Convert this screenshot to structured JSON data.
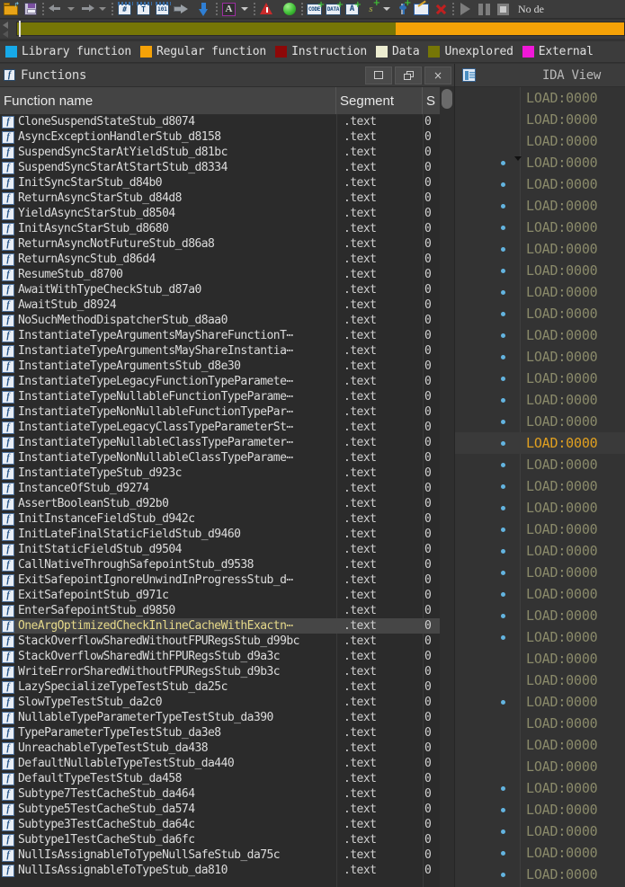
{
  "toolbar": {
    "items": [
      {
        "name": "open-file-icon",
        "kind": "folder"
      },
      {
        "name": "save-icon",
        "kind": "disk"
      },
      {
        "name": "toolbar-separator-1",
        "kind": "sep"
      },
      {
        "name": "navigate-back-icon",
        "kind": "arrow-left"
      },
      {
        "name": "navigate-back-dropdown-icon",
        "kind": "caret"
      },
      {
        "name": "navigate-forward-icon",
        "kind": "arrow-right"
      },
      {
        "name": "navigate-forward-dropdown-icon",
        "kind": "caret-dim"
      },
      {
        "name": "toolbar-separator-2",
        "kind": "sep"
      },
      {
        "name": "make-code-icon",
        "kind": "box",
        "glyph": "#"
      },
      {
        "name": "make-text-icon",
        "kind": "box",
        "glyph": "T"
      },
      {
        "name": "make-data-icon",
        "kind": "box",
        "glyph": "101"
      },
      {
        "name": "jump-icon",
        "kind": "jump"
      },
      {
        "name": "jump-down-icon",
        "kind": "down-arrow"
      },
      {
        "name": "toolbar-separator-3",
        "kind": "sep"
      },
      {
        "name": "font-icon",
        "kind": "letter-a",
        "glyph": "A"
      },
      {
        "name": "font-dropdown-icon",
        "kind": "caret"
      },
      {
        "name": "toolbar-separator-4",
        "kind": "sep"
      },
      {
        "name": "problems-icon",
        "kind": "warn"
      },
      {
        "name": "debugger-status-icon",
        "kind": "green-ball"
      },
      {
        "name": "toolbar-separator-5",
        "kind": "sep"
      },
      {
        "name": "add-code-segment-icon",
        "kind": "label-plus",
        "glyph": "CODE"
      },
      {
        "name": "add-data-segment-icon",
        "kind": "label-plus",
        "glyph": "DATA"
      },
      {
        "name": "add-struct-icon",
        "kind": "box-plus",
        "glyph": "A"
      },
      {
        "name": "add-string-icon",
        "kind": "s-plus",
        "glyph": "s"
      },
      {
        "name": "add-string-dropdown-icon",
        "kind": "caret"
      },
      {
        "name": "add-breakpoint-icon",
        "kind": "pin-plus"
      },
      {
        "name": "edit-icon",
        "kind": "edit"
      },
      {
        "name": "delete-icon",
        "kind": "red-x"
      },
      {
        "name": "toolbar-separator-6",
        "kind": "sep"
      },
      {
        "name": "run-icon",
        "kind": "play"
      },
      {
        "name": "pause-icon",
        "kind": "pause"
      },
      {
        "name": "stop-icon",
        "kind": "stop"
      }
    ],
    "status_text": "No de"
  },
  "navband": {
    "segments": [
      {
        "name": "nav-segment-unexplored",
        "color": "#767606",
        "width_pct": 62.3
      },
      {
        "name": "nav-segment-regular-function",
        "color": "#f5a207",
        "width_pct": 37.7
      }
    ],
    "cursor_pct": 0.35
  },
  "legend": {
    "items": [
      {
        "label": "Library function",
        "color": "#17a9e8"
      },
      {
        "label": "Regular function",
        "color": "#f5a207"
      },
      {
        "label": "Instruction",
        "color": "#8d0808"
      },
      {
        "label": "Data",
        "color": "#ececd0"
      },
      {
        "label": "Unexplored",
        "color": "#767606"
      },
      {
        "label": "External",
        "color": "#f018d8"
      }
    ]
  },
  "functions_panel": {
    "title": "Functions",
    "title_icon": "function-icon",
    "window_buttons": [
      {
        "name": "maximize-button",
        "glyph": "maximize"
      },
      {
        "name": "restore-button",
        "glyph": "restore"
      },
      {
        "name": "close-button",
        "glyph": "×"
      }
    ],
    "columns": [
      "Function name",
      "Segment",
      "S"
    ],
    "selected_index": 33,
    "rows": [
      {
        "name": "CloneSuspendStateStub_d8074",
        "segment": ".text",
        "s": "0"
      },
      {
        "name": "AsyncExceptionHandlerStub_d8158",
        "segment": ".text",
        "s": "0"
      },
      {
        "name": "SuspendSyncStarAtYieldStub_d81bc",
        "segment": ".text",
        "s": "0"
      },
      {
        "name": "SuspendSyncStarAtStartStub_d8334",
        "segment": ".text",
        "s": "0"
      },
      {
        "name": "InitSyncStarStub_d84b0",
        "segment": ".text",
        "s": "0"
      },
      {
        "name": "ReturnAsyncStarStub_d84d8",
        "segment": ".text",
        "s": "0"
      },
      {
        "name": "YieldAsyncStarStub_d8504",
        "segment": ".text",
        "s": "0"
      },
      {
        "name": "InitAsyncStarStub_d8680",
        "segment": ".text",
        "s": "0"
      },
      {
        "name": "ReturnAsyncNotFutureStub_d86a8",
        "segment": ".text",
        "s": "0"
      },
      {
        "name": "ReturnAsyncStub_d86d4",
        "segment": ".text",
        "s": "0"
      },
      {
        "name": "ResumeStub_d8700",
        "segment": ".text",
        "s": "0"
      },
      {
        "name": "AwaitWithTypeCheckStub_d87a0",
        "segment": ".text",
        "s": "0"
      },
      {
        "name": "AwaitStub_d8924",
        "segment": ".text",
        "s": "0"
      },
      {
        "name": "NoSuchMethodDispatcherStub_d8aa0",
        "segment": ".text",
        "s": "0"
      },
      {
        "name": "InstantiateTypeArgumentsMayShareFunctionT⋯",
        "segment": ".text",
        "s": "0"
      },
      {
        "name": "InstantiateTypeArgumentsMayShareInstantia⋯",
        "segment": ".text",
        "s": "0"
      },
      {
        "name": "InstantiateTypeArgumentsStub_d8e30",
        "segment": ".text",
        "s": "0"
      },
      {
        "name": "InstantiateTypeLegacyFunctionTypeParamete⋯",
        "segment": ".text",
        "s": "0"
      },
      {
        "name": "InstantiateTypeNullableFunctionTypeParame⋯",
        "segment": ".text",
        "s": "0"
      },
      {
        "name": "InstantiateTypeNonNullableFunctionTypePar⋯",
        "segment": ".text",
        "s": "0"
      },
      {
        "name": "InstantiateTypeLegacyClassTypeParameterSt⋯",
        "segment": ".text",
        "s": "0"
      },
      {
        "name": "InstantiateTypeNullableClassTypeParameter⋯",
        "segment": ".text",
        "s": "0"
      },
      {
        "name": "InstantiateTypeNonNullableClassTypeParame⋯",
        "segment": ".text",
        "s": "0"
      },
      {
        "name": "InstantiateTypeStub_d923c",
        "segment": ".text",
        "s": "0"
      },
      {
        "name": "InstanceOfStub_d9274",
        "segment": ".text",
        "s": "0"
      },
      {
        "name": "AssertBooleanStub_d92b0",
        "segment": ".text",
        "s": "0"
      },
      {
        "name": "InitInstanceFieldStub_d942c",
        "segment": ".text",
        "s": "0"
      },
      {
        "name": "InitLateFinalStaticFieldStub_d9460",
        "segment": ".text",
        "s": "0"
      },
      {
        "name": "InitStaticFieldStub_d9504",
        "segment": ".text",
        "s": "0"
      },
      {
        "name": "CallNativeThroughSafepointStub_d9538",
        "segment": ".text",
        "s": "0"
      },
      {
        "name": "ExitSafepointIgnoreUnwindInProgressStub_d⋯",
        "segment": ".text",
        "s": "0"
      },
      {
        "name": "ExitSafepointStub_d971c",
        "segment": ".text",
        "s": "0"
      },
      {
        "name": "EnterSafepointStub_d9850",
        "segment": ".text",
        "s": "0"
      },
      {
        "name": "OneArgOptimizedCheckInlineCacheWithExactn⋯",
        "segment": ".text",
        "s": "0"
      },
      {
        "name": "StackOverflowSharedWithoutFPURegsStub_d99bc",
        "segment": ".text",
        "s": "0"
      },
      {
        "name": "StackOverflowSharedWithFPURegsStub_d9a3c",
        "segment": ".text",
        "s": "0"
      },
      {
        "name": "WriteErrorSharedWithoutFPURegsStub_d9b3c",
        "segment": ".text",
        "s": "0"
      },
      {
        "name": "LazySpecializeTypeTestStub_da25c",
        "segment": ".text",
        "s": "0"
      },
      {
        "name": "SlowTypeTestStub_da2c0",
        "segment": ".text",
        "s": "0"
      },
      {
        "name": "NullableTypeParameterTypeTestStub_da390",
        "segment": ".text",
        "s": "0"
      },
      {
        "name": "TypeParameterTypeTestStub_da3e8",
        "segment": ".text",
        "s": "0"
      },
      {
        "name": "UnreachableTypeTestStub_da438",
        "segment": ".text",
        "s": "0"
      },
      {
        "name": "DefaultNullableTypeTestStub_da440",
        "segment": ".text",
        "s": "0"
      },
      {
        "name": "DefaultTypeTestStub_da458",
        "segment": ".text",
        "s": "0"
      },
      {
        "name": "Subtype7TestCacheStub_da464",
        "segment": ".text",
        "s": "0"
      },
      {
        "name": "Subtype5TestCacheStub_da574",
        "segment": ".text",
        "s": "0"
      },
      {
        "name": "Subtype3TestCacheStub_da64c",
        "segment": ".text",
        "s": "0"
      },
      {
        "name": "Subtype1TestCacheStub_da6fc",
        "segment": ".text",
        "s": "0"
      },
      {
        "name": "NullIsAssignableToTypeNullSafeStub_da75c",
        "segment": ".text",
        "s": "0"
      },
      {
        "name": "NullIsAssignableToTypeStub_da810",
        "segment": ".text",
        "s": "0"
      }
    ]
  },
  "ida_view_panel": {
    "title": "IDA View",
    "title_icon": "ida-view-icon",
    "highlight_index": 16,
    "chevron_index": 3,
    "rows": [
      {
        "address": "LOAD:0000",
        "dot": false
      },
      {
        "address": "LOAD:0000",
        "dot": false
      },
      {
        "address": "LOAD:0000",
        "dot": false
      },
      {
        "address": "LOAD:0000",
        "dot": true
      },
      {
        "address": "LOAD:0000",
        "dot": true
      },
      {
        "address": "LOAD:0000",
        "dot": true
      },
      {
        "address": "LOAD:0000",
        "dot": true
      },
      {
        "address": "LOAD:0000",
        "dot": true
      },
      {
        "address": "LOAD:0000",
        "dot": true
      },
      {
        "address": "LOAD:0000",
        "dot": true
      },
      {
        "address": "LOAD:0000",
        "dot": true
      },
      {
        "address": "LOAD:0000",
        "dot": true
      },
      {
        "address": "LOAD:0000",
        "dot": true
      },
      {
        "address": "LOAD:0000",
        "dot": true
      },
      {
        "address": "LOAD:0000",
        "dot": true
      },
      {
        "address": "LOAD:0000",
        "dot": true
      },
      {
        "address": "LOAD:0000",
        "dot": true
      },
      {
        "address": "LOAD:0000",
        "dot": true
      },
      {
        "address": "LOAD:0000",
        "dot": true
      },
      {
        "address": "LOAD:0000",
        "dot": true
      },
      {
        "address": "LOAD:0000",
        "dot": true
      },
      {
        "address": "LOAD:0000",
        "dot": true
      },
      {
        "address": "LOAD:0000",
        "dot": true
      },
      {
        "address": "LOAD:0000",
        "dot": true
      },
      {
        "address": "LOAD:0000",
        "dot": true
      },
      {
        "address": "LOAD:0000",
        "dot": true
      },
      {
        "address": "LOAD:0000",
        "dot": false
      },
      {
        "address": "LOAD:0000",
        "dot": false
      },
      {
        "address": "LOAD:0000",
        "dot": true
      },
      {
        "address": "LOAD:0000",
        "dot": false
      },
      {
        "address": "LOAD:0000",
        "dot": false
      },
      {
        "address": "LOAD:0000",
        "dot": false
      },
      {
        "address": "LOAD:0000",
        "dot": true
      },
      {
        "address": "LOAD:0000",
        "dot": true
      },
      {
        "address": "LOAD:0000",
        "dot": true
      },
      {
        "address": "LOAD:0000",
        "dot": true
      },
      {
        "address": "LOAD:0000",
        "dot": true
      }
    ]
  }
}
